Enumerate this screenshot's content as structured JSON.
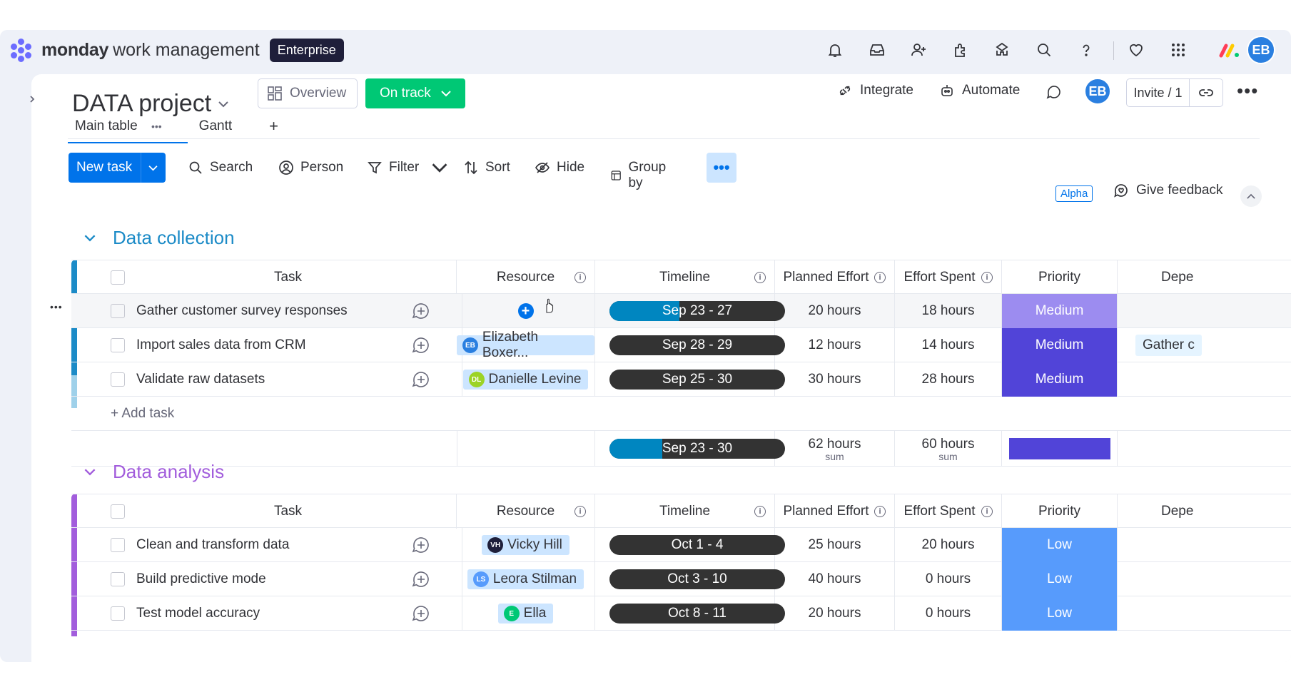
{
  "brand": {
    "name": "monday",
    "sub": "work management",
    "badge": "Enterprise"
  },
  "topbar": {
    "icons": [
      "bell-icon",
      "inbox-icon",
      "invite-members-icon",
      "apps-icon",
      "integrations-icon",
      "search-icon",
      "help-icon",
      "heart-icon",
      "grid-menu-icon"
    ],
    "avatar": "EB"
  },
  "project": {
    "title": "DATA project",
    "overview": "Overview",
    "status": "On track",
    "integrate": "Integrate",
    "automate": "Automate",
    "avatar": "EB",
    "invite": "Invite / 1"
  },
  "tabs": [
    {
      "label": "Main table"
    },
    {
      "label": "Gantt"
    }
  ],
  "toolbar": {
    "new_task": "New task",
    "search": "Search",
    "person": "Person",
    "filter": "Filter",
    "sort": "Sort",
    "hide": "Hide",
    "group_by": "Group by",
    "alpha": "Alpha",
    "feedback": "Give feedback"
  },
  "columns": {
    "task": "Task",
    "resource": "Resource",
    "timeline": "Timeline",
    "planned": "Planned Effort",
    "spent": "Effort Spent",
    "priority": "Priority",
    "dependency": "Depe"
  },
  "groups": [
    {
      "title": "Data collection",
      "color": "#1c8bc7",
      "add_task": "+ Add task",
      "rows": [
        {
          "task": "Gather customer survey responses",
          "resource": "",
          "timeline": "Sep 23 - 27",
          "progress": 0.4,
          "planned": "20 hours",
          "spent": "18 hours",
          "priority": "Medium",
          "priority_color": "#9c8cf0",
          "dependency": ""
        },
        {
          "task": "Import sales data from CRM",
          "resource": "Elizabeth Boxer...",
          "initials": "EB",
          "av_color": "#2a7fe0",
          "timeline": "Sep 28 - 29",
          "progress": 0,
          "planned": "12 hours",
          "spent": "14 hours",
          "priority": "Medium",
          "priority_color": "#5144d8",
          "dependency": "Gather c"
        },
        {
          "task": "Validate raw datasets",
          "resource": "Danielle Levine",
          "initials": "DL",
          "av_color": "#9cd326",
          "timeline": "Sep 25 - 30",
          "progress": 0,
          "planned": "30 hours",
          "spent": "28 hours",
          "priority": "Medium",
          "priority_color": "#5144d8",
          "dependency": ""
        }
      ],
      "summary": {
        "timeline": "Sep 23 - 30",
        "progress": 0.3,
        "planned": "62 hours",
        "spent": "60 hours",
        "label": "sum",
        "priority_color": "#5144d8"
      }
    },
    {
      "title": "Data analysis",
      "color": "#a25ddc",
      "rows": [
        {
          "task": "Clean and transform data",
          "resource": "Vicky Hill",
          "initials": "VH",
          "av_color": "#1f1f3a",
          "timeline": "Oct 1 - 4",
          "progress": 0,
          "planned": "25 hours",
          "spent": "20 hours",
          "priority": "Low",
          "priority_color": "#579bfc"
        },
        {
          "task": "Build predictive mode",
          "resource": "Leora Stilman",
          "initials": "LS",
          "av_color": "#579bfc",
          "timeline": "Oct 3 - 10",
          "progress": 0,
          "planned": "40 hours",
          "spent": "0 hours",
          "priority": "Low",
          "priority_color": "#579bfc"
        },
        {
          "task": "Test model accuracy",
          "resource": "Ella",
          "initials": "E",
          "av_color": "#00c875",
          "timeline": "Oct 8 - 11",
          "progress": 0,
          "planned": "20 hours",
          "spent": "0 hours",
          "priority": "Low",
          "priority_color": "#579bfc"
        }
      ]
    }
  ]
}
